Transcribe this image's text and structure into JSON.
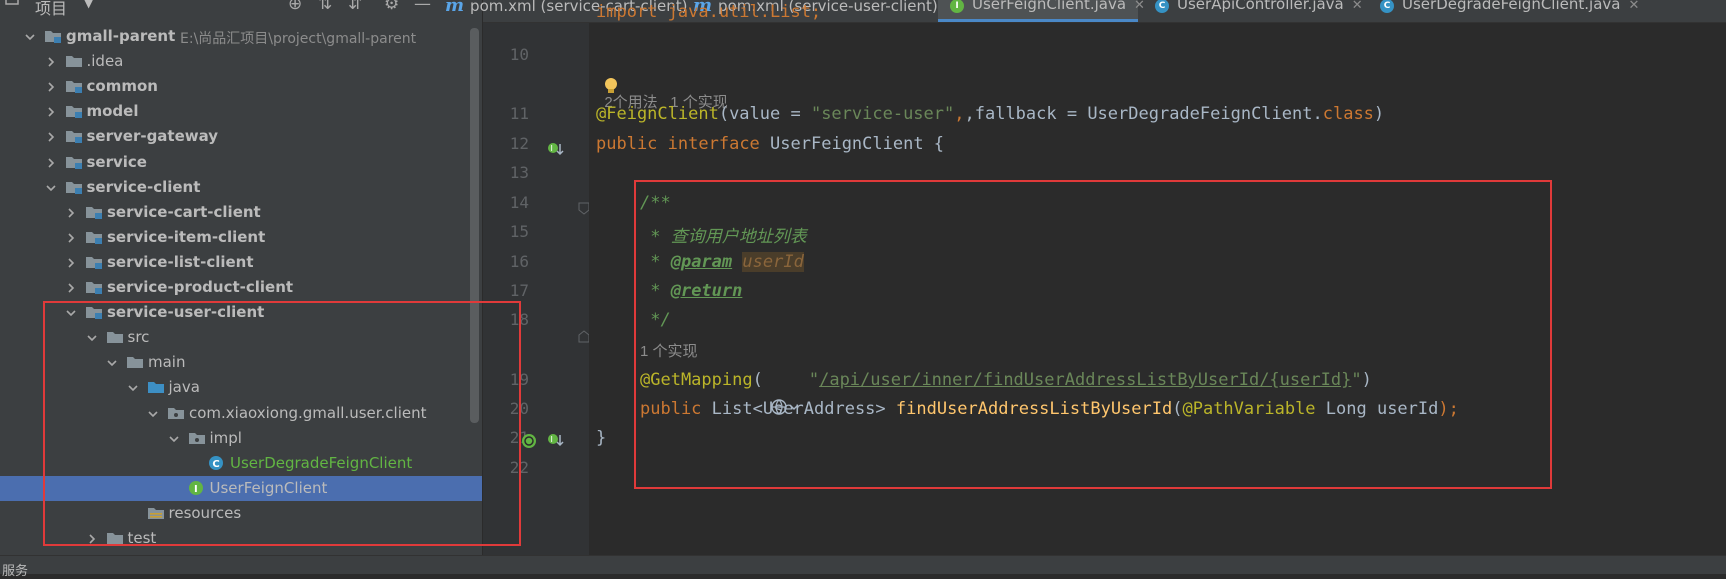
{
  "project_panel": {
    "title": "项目",
    "tree": [
      {
        "label": "gmall-parent",
        "path": "E:\\尚品汇项目\\project\\gmall-parent",
        "indent": 0,
        "expanded": true,
        "icon": "module-folder-icon",
        "bold": true
      },
      {
        "label": ".idea",
        "indent": 1,
        "expanded": false,
        "icon": "folder-icon"
      },
      {
        "label": "common",
        "indent": 1,
        "expanded": false,
        "icon": "module-folder-icon",
        "bold": true
      },
      {
        "label": "model",
        "indent": 1,
        "expanded": false,
        "icon": "module-folder-icon",
        "bold": true
      },
      {
        "label": "server-gateway",
        "indent": 1,
        "expanded": false,
        "icon": "module-folder-icon",
        "bold": true
      },
      {
        "label": "service",
        "indent": 1,
        "expanded": false,
        "icon": "module-folder-icon",
        "bold": true
      },
      {
        "label": "service-client",
        "indent": 1,
        "expanded": true,
        "icon": "module-folder-icon",
        "bold": true
      },
      {
        "label": "service-cart-client",
        "indent": 2,
        "expanded": false,
        "icon": "module-folder-icon",
        "bold": true
      },
      {
        "label": "service-item-client",
        "indent": 2,
        "expanded": false,
        "icon": "module-folder-icon",
        "bold": true
      },
      {
        "label": "service-list-client",
        "indent": 2,
        "expanded": false,
        "icon": "module-folder-icon",
        "bold": true
      },
      {
        "label": "service-product-client",
        "indent": 2,
        "expanded": false,
        "icon": "module-folder-icon",
        "bold": true
      },
      {
        "label": "service-user-client",
        "indent": 2,
        "expanded": true,
        "icon": "module-folder-icon",
        "bold": true
      },
      {
        "label": "src",
        "indent": 3,
        "expanded": true,
        "icon": "folder-icon"
      },
      {
        "label": "main",
        "indent": 4,
        "expanded": true,
        "icon": "folder-icon"
      },
      {
        "label": "java",
        "indent": 5,
        "expanded": true,
        "icon": "source-folder-icon"
      },
      {
        "label": "com.xiaoxiong.gmall.user.client",
        "indent": 6,
        "expanded": true,
        "icon": "package-icon"
      },
      {
        "label": "impl",
        "indent": 7,
        "expanded": true,
        "icon": "package-icon"
      },
      {
        "label": "UserDegradeFeignClient",
        "indent": 8,
        "leaf": true,
        "icon": "class-icon",
        "color": "#62b543"
      },
      {
        "label": "UserFeignClient",
        "indent": 7,
        "leaf": true,
        "icon": "interface-icon",
        "selected": true
      },
      {
        "label": "resources",
        "indent": 5,
        "leaf": true,
        "icon": "resources-folder-icon"
      },
      {
        "label": "test",
        "indent": 3,
        "expanded": false,
        "icon": "folder-icon"
      }
    ]
  },
  "tabs": [
    {
      "label": "pom.xml (service-cart-client)",
      "icon": "maven-icon",
      "active": false
    },
    {
      "label": "pom.xml (service-user-client)",
      "icon": "maven-icon",
      "active": false
    },
    {
      "label": "UserFeignClient.java",
      "icon": "interface-icon",
      "active": true
    },
    {
      "label": "UserApiController.java",
      "icon": "class-icon",
      "active": false
    },
    {
      "label": "UserDegradeFeignClient.java",
      "icon": "class-icon",
      "active": false
    }
  ],
  "editor": {
    "top_fragment": "import java.util.List;",
    "line_numbers": [
      "10",
      "11",
      "12",
      "13",
      "14",
      "15",
      "16",
      "17",
      "18",
      "19",
      "20",
      "21",
      "22"
    ],
    "hint_usages": "2个用法   1 个实现",
    "hint_impl": "1 个实现",
    "l11": {
      "ann": "@FeignClient",
      "p1": "(value = ",
      "str": "\"service-user\"",
      "p2": ",fallback = UserDegradeFeignClient.",
      "cls": "class",
      "p3": ")"
    },
    "l12": {
      "kw1": "public",
      "kw2": "interface",
      "name": "UserFeignClient {"
    },
    "l14": "/**",
    "l15": " * 查询用户地址列表",
    "l16": {
      "star": " * ",
      "tag": "@param",
      "val": "userId"
    },
    "l17": {
      "star": " * ",
      "tag": "@return"
    },
    "l18": " */",
    "l19": {
      "ann": "@GetMapping",
      "p1": "(",
      "q1": "\"",
      "url": "/api/user/inner/findUserAddressListByUserId/{userId}",
      "q2": "\"",
      "p2": ")"
    },
    "l20": {
      "kw": "public",
      "type": " List<UserAddress> ",
      "fn": "findUserAddressListByUserId",
      "p1": "(",
      "ann": "@PathVariable",
      "p2": " Long userId",
      ",semi": ");",
      "semi": ");"
    },
    "l21": "}"
  },
  "status_bar": {
    "label": "服务"
  },
  "colors": {
    "highlight_box": "#e03a3a",
    "selection": "#4b6eaf"
  }
}
